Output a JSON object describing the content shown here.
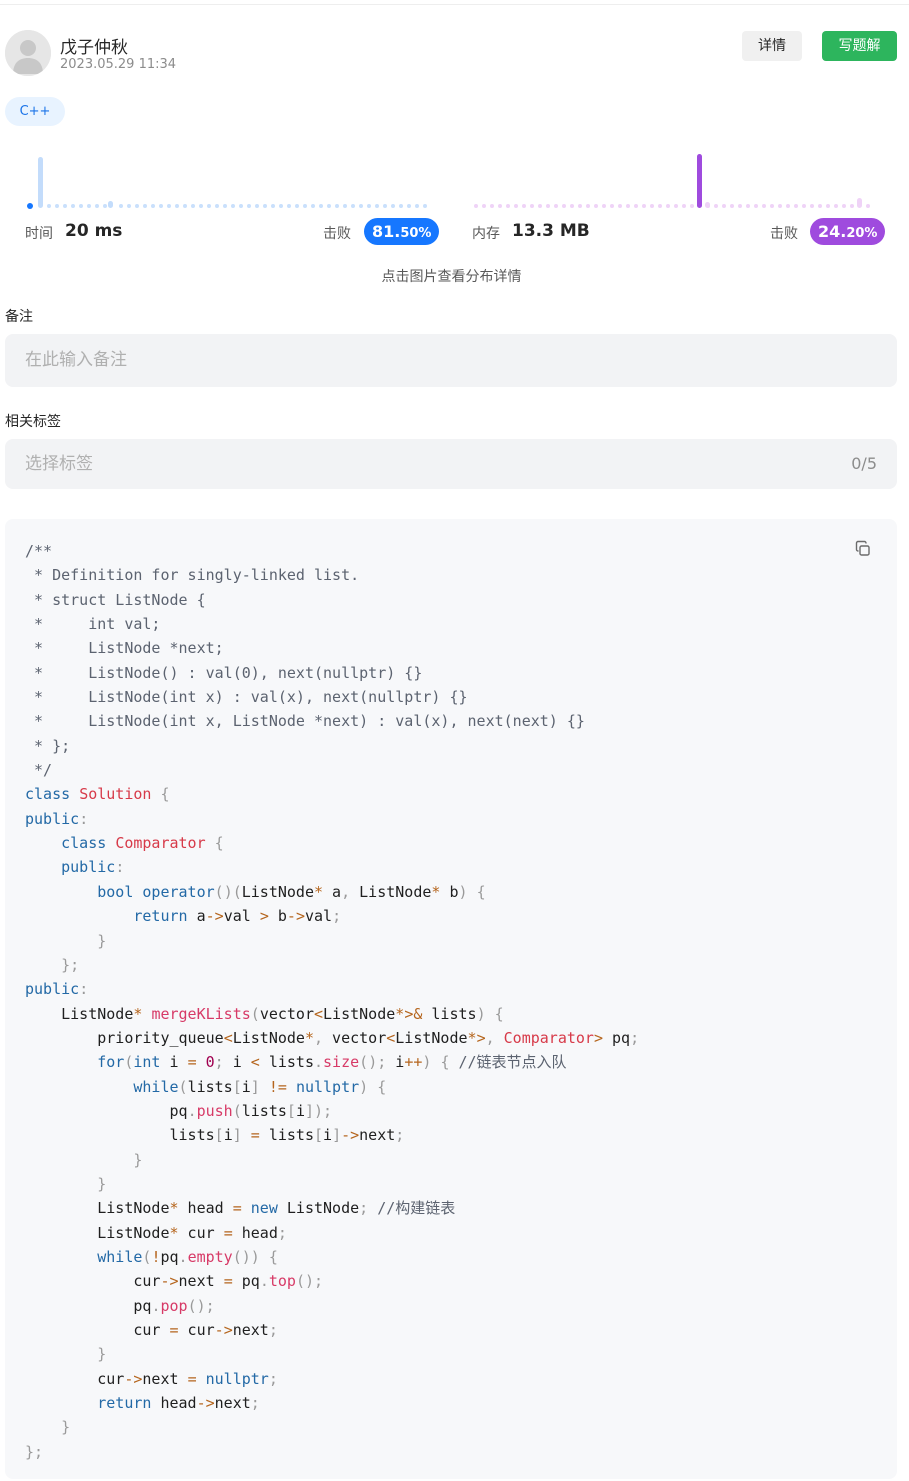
{
  "author": {
    "name": "戊子仲秋",
    "datetime": "2023.05.29 11:34"
  },
  "actions": {
    "detail_label": "详情",
    "write_solution_label": "写题解"
  },
  "language_tag": "C++",
  "stats": {
    "time": {
      "label": "时间",
      "value": "20 ms",
      "beat_label": "击败",
      "beat_percent_main": "81.",
      "beat_percent_tail": "50%",
      "beat_percent": 81.5,
      "color": "#1677ff"
    },
    "memory": {
      "label": "内存",
      "value": "13.3 MB",
      "beat_label": "击败",
      "beat_percent_main": "24.",
      "beat_percent_tail": "20%",
      "beat_percent": 24.2,
      "color": "#9f4bde"
    },
    "hint": "点击图片查看分布详情"
  },
  "note": {
    "label": "备注",
    "placeholder": "在此输入备注"
  },
  "tags": {
    "label": "相关标签",
    "placeholder": "选择标签",
    "count": "0/5"
  },
  "code": {
    "language": "cpp",
    "lines": [
      "/**",
      " * Definition for singly-linked list.",
      " * struct ListNode {",
      " *     int val;",
      " *     ListNode *next;",
      " *     ListNode() : val(0), next(nullptr) {}",
      " *     ListNode(int x) : val(x), next(nullptr) {}",
      " *     ListNode(int x, ListNode *next) : val(x), next(next) {}",
      " * };",
      " */",
      "class Solution {",
      "public:",
      "    class Comparator {",
      "    public:",
      "        bool operator()(ListNode* a, ListNode* b) {",
      "            return a->val > b->val;",
      "        }",
      "    };",
      "public:",
      "    ListNode* mergeKLists(vector<ListNode*>& lists) {",
      "        priority_queue<ListNode*, vector<ListNode*>, Comparator> pq;",
      "        for(int i = 0; i < lists.size(); i++) { //链表节点入队",
      "            while(lists[i] != nullptr) {",
      "                pq.push(lists[i]);",
      "                lists[i] = lists[i]->next;",
      "            }",
      "        }",
      "        ListNode* head = new ListNode; //构建链表",
      "        ListNode* cur = head;",
      "        while(!pq.empty()) {",
      "            cur->next = pq.top();",
      "            pq.pop();",
      "            cur = cur->next;",
      "        }",
      "        cur->next = nullptr;",
      "        return head->next;",
      "    }",
      "};"
    ]
  },
  "icons": {
    "avatar": "default-user-avatar",
    "copy": "copy-icon"
  }
}
